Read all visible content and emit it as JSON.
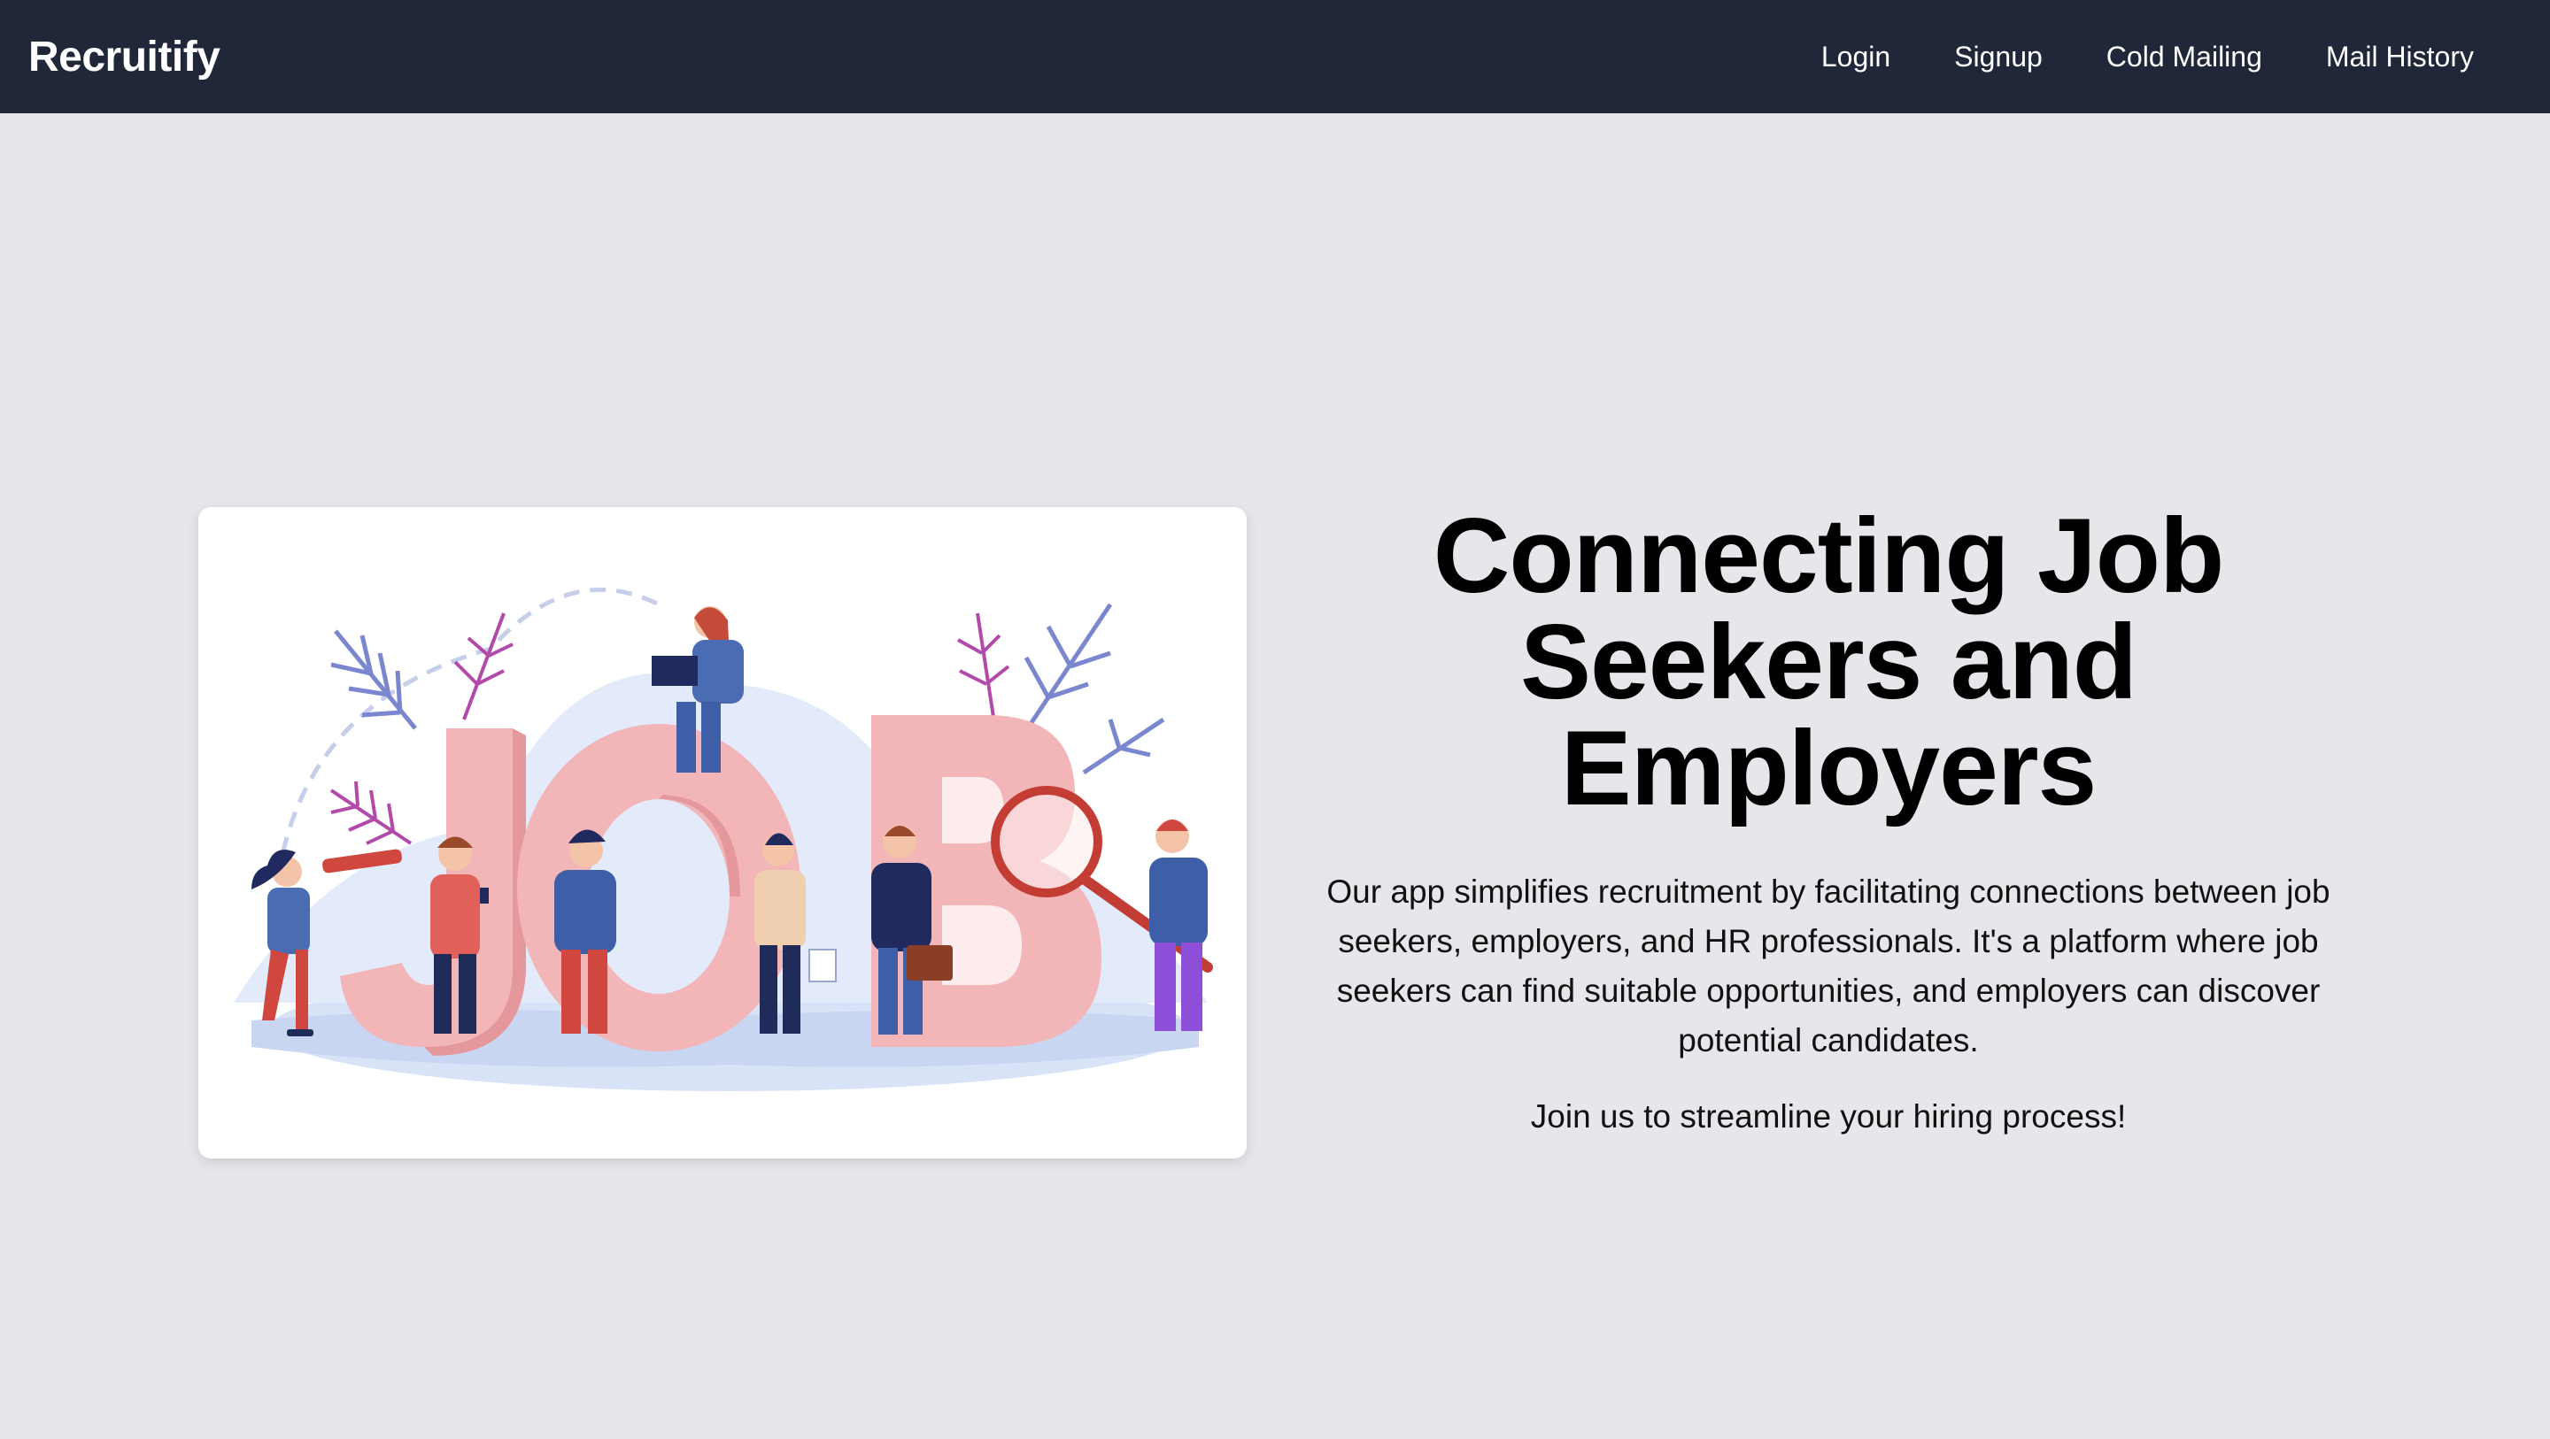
{
  "navbar": {
    "brand": "Recruitify",
    "links": [
      "Login",
      "Signup",
      "Cold Mailing",
      "Mail History"
    ]
  },
  "hero": {
    "illustration_letters": "JOB",
    "title": "Connecting Job Seekers and Employers",
    "description": "Our app simplifies recruitment by facilitating connections between job seekers, employers, and HR professionals. It's a platform where job seekers can find suitable opportunities, and employers can discover potential candidates.",
    "cta": "Join us to streamline your hiring process!"
  },
  "colors": {
    "navbar_bg": "#202738",
    "page_bg": "#e5e7eb",
    "letters_pink": "#f2b5b8",
    "accent_red": "#d0473f"
  }
}
